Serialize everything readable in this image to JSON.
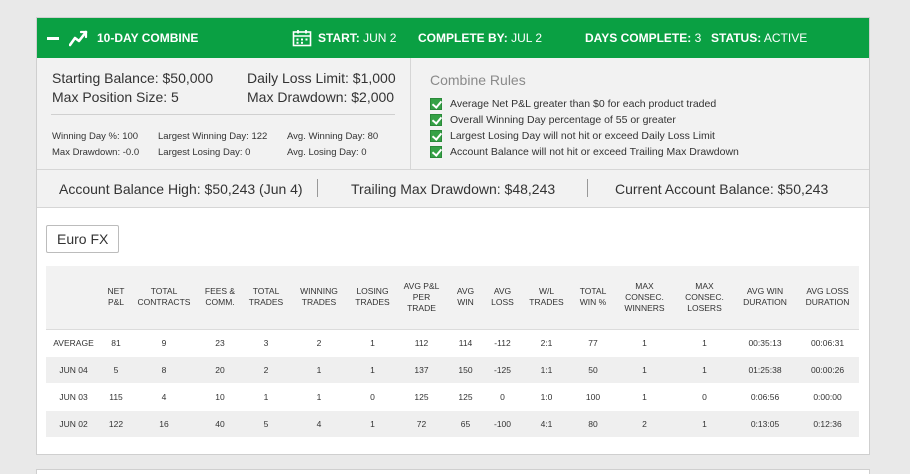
{
  "header": {
    "title": "10-DAY COMBINE",
    "start_label": "START:",
    "start_value": "JUN 2",
    "complete_by_label": "COMPLETE BY:",
    "complete_by_value": "JUL 2",
    "days_complete_label": "DAYS COMPLETE:",
    "days_complete_value": "3",
    "status_label": "STATUS:",
    "status_value": "ACTIVE",
    "bg_color": "#0aa043"
  },
  "summary": {
    "starting_balance": "Starting Balance: $50,000",
    "max_position_size": "Max Position Size: 5",
    "daily_loss_limit": "Daily Loss Limit: $1,000",
    "max_drawdown": "Max Drawdown: $2,000",
    "winning_day_pct": "Winning Day %: 100",
    "max_drawdown_small": "Max Drawdown: -0.0",
    "largest_winning_day": "Largest Winning Day: 122",
    "largest_losing_day": "Largest Losing Day: 0",
    "avg_winning_day": "Avg. Winning Day: 80",
    "avg_losing_day": "Avg. Losing Day: 0"
  },
  "rules": {
    "title": "Combine Rules",
    "items": [
      "Average Net P&L greater than $0 for each product traded",
      "Overall Winning Day percentage of 55 or greater",
      "Largest Losing Day will not hit or exceed Daily Loss Limit",
      "Account Balance will not hit or exceed Trailing Max Drawdown"
    ]
  },
  "balances": {
    "high": "Account Balance High: $50,243 (Jun 4)",
    "trailing": "Trailing Max Drawdown: $48,243",
    "current": "Current Account Balance: $50,243"
  },
  "product_tab": "Euro FX",
  "table": {
    "headers": [
      "",
      "NET P&L",
      "TOTAL CONTRACTS",
      "FEES & COMM.",
      "TOTAL TRADES",
      "WINNING TRADES",
      "LOSING TRADES",
      "AVG P&L PER TRADE",
      "AVG WIN",
      "AVG LOSS",
      "W/L TRADES",
      "TOTAL WIN %",
      "MAX CONSEC. WINNERS",
      "MAX CONSEC. LOSERS",
      "AVG WIN DURATION",
      "AVG LOSS DURATION"
    ],
    "rows": [
      [
        "AVERAGE",
        "81",
        "9",
        "23",
        "3",
        "2",
        "1",
        "112",
        "114",
        "-112",
        "2:1",
        "77",
        "1",
        "1",
        "00:35:13",
        "00:06:31"
      ],
      [
        "JUN 04",
        "5",
        "8",
        "20",
        "2",
        "1",
        "1",
        "137",
        "150",
        "-125",
        "1:1",
        "50",
        "1",
        "1",
        "01:25:38",
        "00:00:26"
      ],
      [
        "JUN 03",
        "115",
        "4",
        "10",
        "1",
        "1",
        "0",
        "125",
        "125",
        "0",
        "1:0",
        "100",
        "1",
        "0",
        "0:06:56",
        "0:00:00"
      ],
      [
        "JUN 02",
        "122",
        "16",
        "40",
        "5",
        "4",
        "1",
        "72",
        "65",
        "-100",
        "4:1",
        "80",
        "2",
        "1",
        "0:13:05",
        "0:12:36"
      ]
    ]
  }
}
